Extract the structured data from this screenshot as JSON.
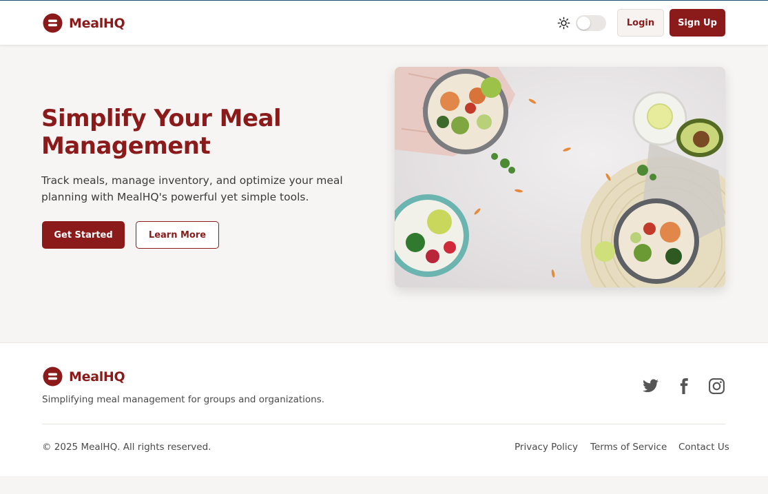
{
  "header": {
    "brand": "MealHQ",
    "theme_icon": "sun-icon",
    "login_label": "Login",
    "signup_label": "Sign Up"
  },
  "hero": {
    "title": "Simplify Your Meal Management",
    "subtitle": "Track meals, manage inventory, and optimize your meal planning with MealHQ's powerful yet simple tools.",
    "primary_button": "Get Started",
    "secondary_button": "Learn More"
  },
  "footer": {
    "brand": "MealHQ",
    "tagline": "Simplifying meal management for groups and organizations.",
    "social_icons": [
      "twitter-icon",
      "facebook-icon",
      "instagram-icon"
    ],
    "copyright": "© 2025 MealHQ. All rights reserved.",
    "links": [
      "Privacy Policy",
      "Terms of Service",
      "Contact Us"
    ]
  },
  "colors": {
    "brand": "#8b1a1a",
    "background": "#f7f5f3",
    "surface": "#ffffff"
  }
}
